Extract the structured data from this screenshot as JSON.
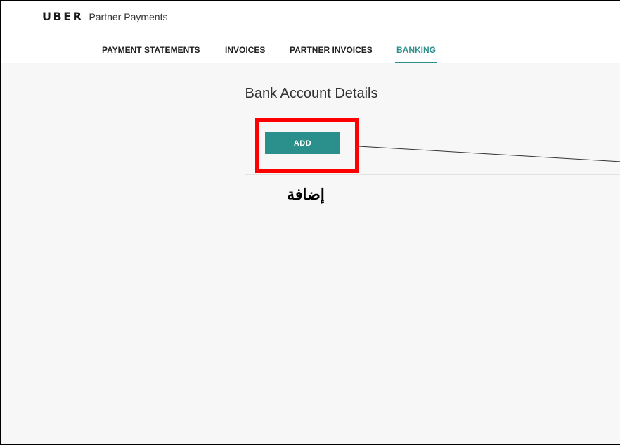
{
  "header": {
    "brand_logo": "UBER",
    "brand_name": "Partner Payments"
  },
  "nav": {
    "items": [
      {
        "label": "PAYMENT STATEMENTS",
        "active": false
      },
      {
        "label": "INVOICES",
        "active": false
      },
      {
        "label": "PARTNER INVOICES",
        "active": false
      },
      {
        "label": "BANKING",
        "active": true
      }
    ]
  },
  "main": {
    "title": "Bank Account Details",
    "add_button_label": "ADD"
  },
  "annotation": {
    "text": "إضافة"
  },
  "colors": {
    "accent": "#2b8f8c",
    "highlight": "#ff0000"
  }
}
